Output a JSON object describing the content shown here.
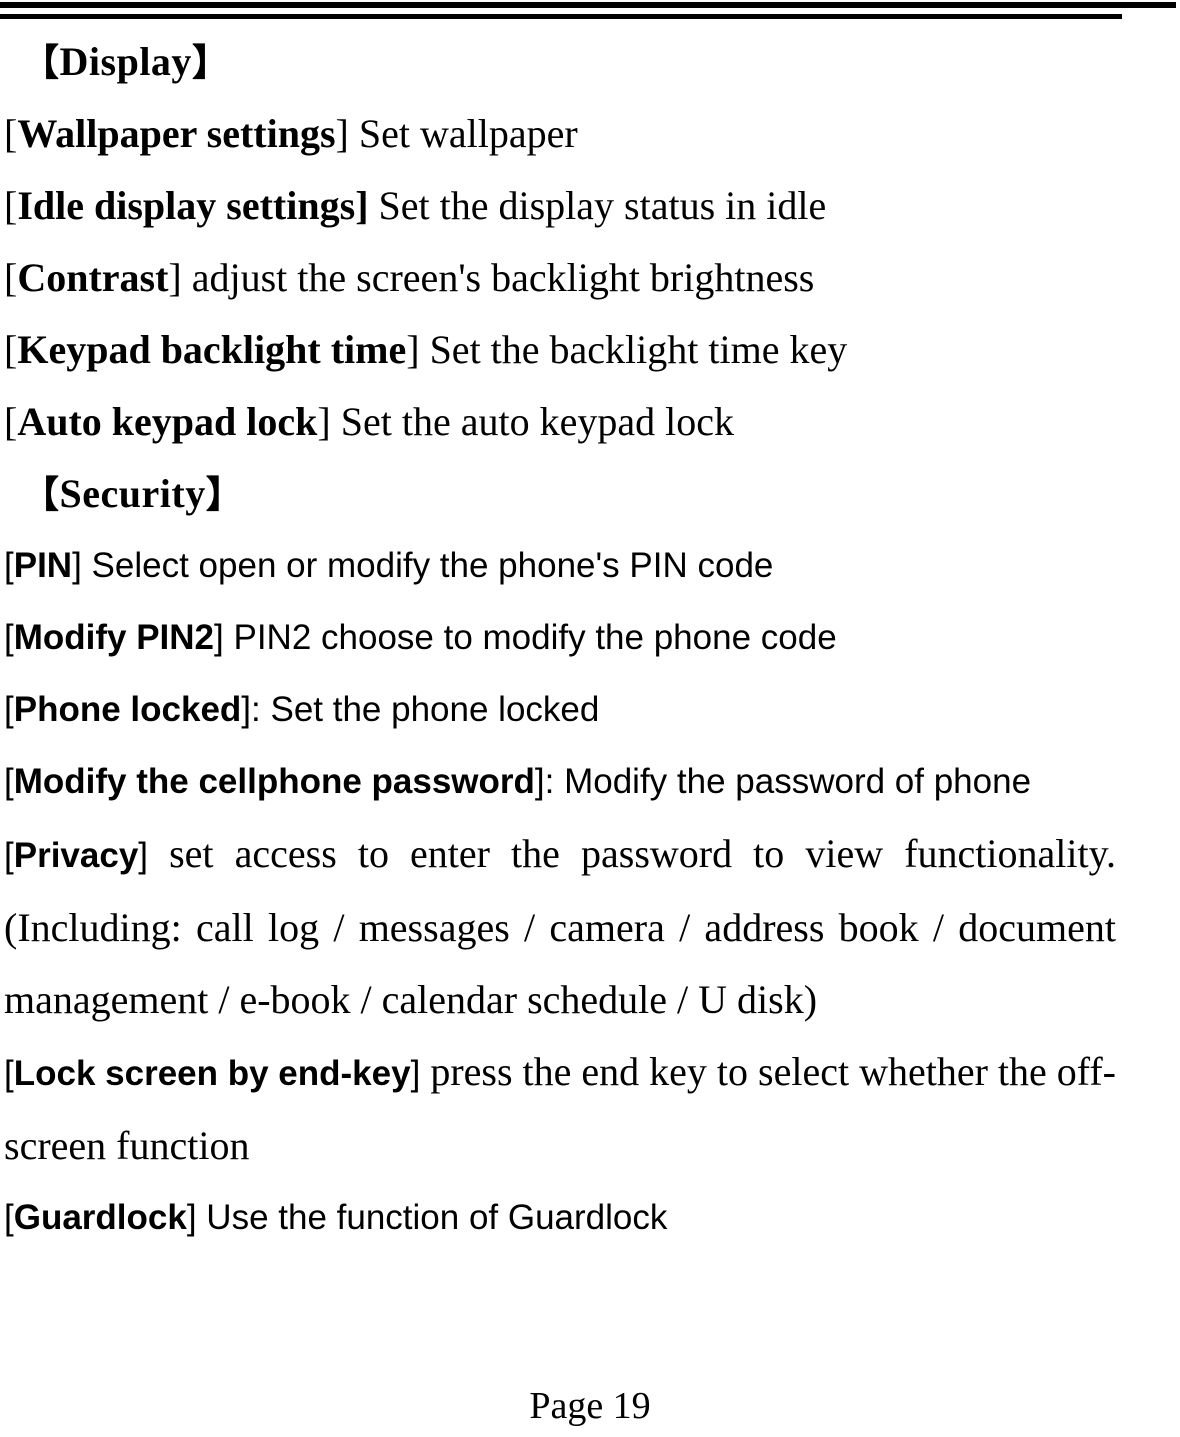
{
  "document": {
    "page_label": "Page 19",
    "sections": [
      {
        "heading_open": "【",
        "heading_text": "Display",
        "heading_close": "】",
        "entries": [
          {
            "open": "[",
            "term": "Wallpaper settings",
            "close": "]",
            "description": " Set wallpaper"
          },
          {
            "open": "[",
            "term": "Idle display settings",
            "close": "]",
            "description": " Set the display status in idle"
          },
          {
            "open": "[",
            "term": "Contrast",
            "close": "]",
            "description": " adjust the screen's backlight brightness"
          },
          {
            "open": "[",
            "term": "Keypad backlight time",
            "close": "]",
            "description": " Set the backlight time key"
          },
          {
            "open": "[",
            "term": "Auto keypad lock",
            "close": "]",
            "description": " Set the auto keypad lock"
          }
        ]
      },
      {
        "heading_open": "【",
        "heading_text": "Security",
        "heading_close": "】",
        "entries": [
          {
            "open": "[",
            "term": "PIN",
            "close": "]",
            "description": " Select open or modify the phone's PIN code"
          },
          {
            "open": "[",
            "term": "Modify PIN2",
            "close": "]",
            "description": " PIN2 choose to modify the phone code"
          },
          {
            "open": "[",
            "term": "Phone locked",
            "close": "]",
            "description": ": Set the phone locked"
          },
          {
            "open": "[",
            "term": "Modify the cellphone password",
            "close": "]",
            "description": ": Modify the password of phone"
          },
          {
            "open": "[",
            "term": "Privacy",
            "close": "]",
            "description": " set access to enter the password to view functionality. (Including: call log / messages / camera / address book / document management / e-book / calendar schedule / U disk)"
          },
          {
            "open": "[",
            "term": "Lock screen by end-key",
            "close": "]",
            "description": " press the end key to select whether the off-screen function"
          },
          {
            "open": "[",
            "term": "Guardlock",
            "close": "]",
            "description": " Use the function of Guardlock"
          }
        ]
      }
    ]
  }
}
